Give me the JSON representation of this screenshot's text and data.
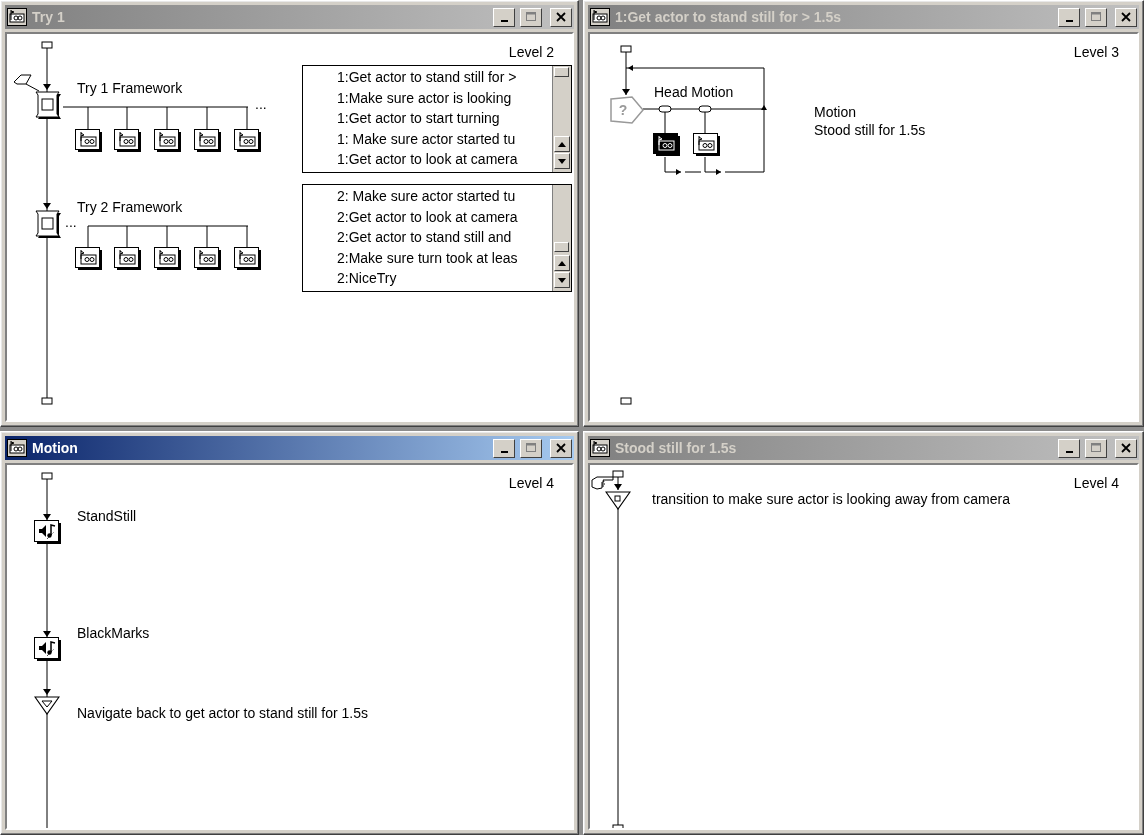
{
  "windows": [
    {
      "kind": "framework",
      "title": "Try 1",
      "active": false,
      "level_label": "Level 2",
      "frameworks": [
        {
          "label": "Try 1 Framework",
          "ellipsis": "..."
        },
        {
          "label": "Try 2 Framework",
          "ellipsis": "..."
        }
      ],
      "lists": [
        {
          "items": [
            "1:Get actor to stand still for >",
            "1:Make sure actor is looking",
            "1:Get actor to start turning",
            "1: Make sure actor started tu",
            "1:Get actor to look at camera"
          ]
        },
        {
          "items": [
            "2: Make sure actor started tu",
            "2:Get actor to look at camera",
            "2:Get actor to stand still and",
            "2:Make sure turn took at leas",
            "2:NiceTry"
          ]
        }
      ]
    },
    {
      "kind": "decision",
      "title": "1:Get actor to stand still for > 1.5s",
      "active": false,
      "level_label": "Level 3",
      "decision": {
        "label": "Head Motion",
        "glyph": "?",
        "paths": [
          {
            "selected": true
          },
          {
            "selected": false
          }
        ]
      },
      "notes": [
        "Motion",
        "Stood still for 1.5s"
      ]
    },
    {
      "kind": "sequence",
      "title": "Motion",
      "active": true,
      "level_label": "Level 4",
      "steps": [
        {
          "kind": "media",
          "label": "StandStill"
        },
        {
          "kind": "media",
          "label": "BlackMarks"
        },
        {
          "kind": "navigate",
          "label": "Navigate back to get actor to stand still for 1.5s"
        }
      ]
    },
    {
      "kind": "transition",
      "title": "Stood still for 1.5s",
      "active": false,
      "level_label": "Level 4",
      "steps": [
        {
          "kind": "transition",
          "label": "transition to make sure actor is looking away from camera"
        }
      ]
    }
  ]
}
